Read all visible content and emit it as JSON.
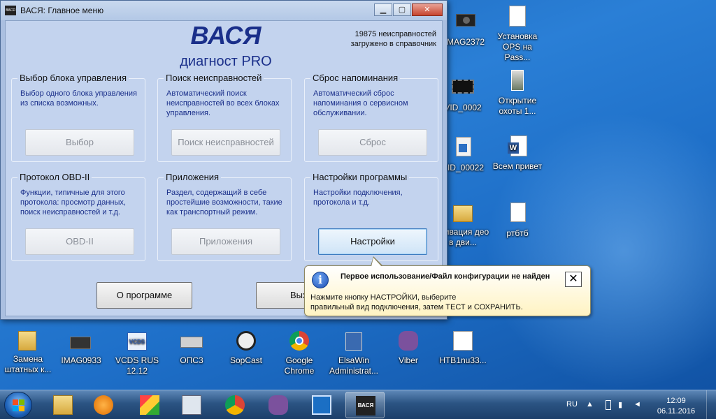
{
  "window": {
    "title": "ВАСЯ:  Главное меню",
    "app_icon": "ВАСЯ",
    "brand_main": "ВАСЯ",
    "brand_sub": "диагност PRO",
    "info_line1": "19875 неисправностей",
    "info_line2": "загружено в справочник"
  },
  "groups": [
    {
      "title": "Выбор блока управления",
      "desc": "Выбор одного блока управления из списка возможных.",
      "button": "Выбор"
    },
    {
      "title": "Поиск неисправностей",
      "desc": "Автоматический поиск неисправностей во всех блоках управления.",
      "button": "Поиск неисправностей"
    },
    {
      "title": "Сброс напоминания",
      "desc": "Автоматический сброс напоминания о сервисном обслуживании.",
      "button": "Сброс"
    },
    {
      "title": "Протокол OBD-II",
      "desc": "Функции, типичные для этого протокола: просмотр данных, поиск неисправностей и т.д.",
      "button": "OBD-II"
    },
    {
      "title": "Приложения",
      "desc": "Раздел, содержащий в себе простейшие возможности, такие как транспортный режим.",
      "button": "Приложения"
    },
    {
      "title": "Настройки программы",
      "desc": "Настройки подключения, протокола и т.д.",
      "button": "Настройки"
    }
  ],
  "bottom_buttons": {
    "about": "О программе",
    "exit": "Вых"
  },
  "balloon": {
    "title": "Первое использование/Файл конфигурации не найден",
    "close": "✕",
    "line1": "Нажмите кнопку НАСТРОЙКИ, выберите",
    "line2": "правильный вид подключения, затем ТЕСТ и СОХРАНИТЬ."
  },
  "desktop_icons_right": [
    {
      "label": "MAG2372",
      "icon": "camera-icon"
    },
    {
      "label": "Установка OPS на Pass...",
      "icon": "document-icon"
    },
    {
      "label": "VID_0002",
      "icon": "video-icon"
    },
    {
      "label": "Открытие охоты 1...",
      "icon": "image-icon"
    },
    {
      "label": "VID_00022",
      "icon": "audio-file-icon"
    },
    {
      "label": "Всем привет",
      "icon": "word-icon"
    },
    {
      "label": "ктивация део в дви...",
      "icon": "folder-icon"
    },
    {
      "label": "ртбтб",
      "icon": "text-file-icon"
    }
  ],
  "desktop_icons_bottom": [
    {
      "label": "Замена штатных к...",
      "icon": "folder-icon"
    },
    {
      "label": "IMAG0933",
      "icon": "image-icon"
    },
    {
      "label": "VCDS RUS 12.12",
      "icon": "vcds-icon"
    },
    {
      "label": "ОПС3",
      "icon": "ops-icon"
    },
    {
      "label": "SopCast",
      "icon": "sopcast-icon"
    },
    {
      "label": "Google Chrome",
      "icon": "chrome-icon"
    },
    {
      "label": "ElsaWin Administrat...",
      "icon": "elsawin-icon"
    },
    {
      "label": "Viber",
      "icon": "viber-icon"
    },
    {
      "label": "HTB1nu33...",
      "icon": "image-icon"
    }
  ],
  "taskbar": {
    "items": [
      "file-explorer-icon",
      "media-player-icon",
      "paint-icon",
      "calculator-icon",
      "chrome-icon",
      "viber-icon",
      "teamviewer-icon",
      "vasya-app-icon"
    ],
    "vasya_label": "ВАСЯ",
    "lang": "RU",
    "time": "12:09",
    "date": "06.11.2016"
  }
}
